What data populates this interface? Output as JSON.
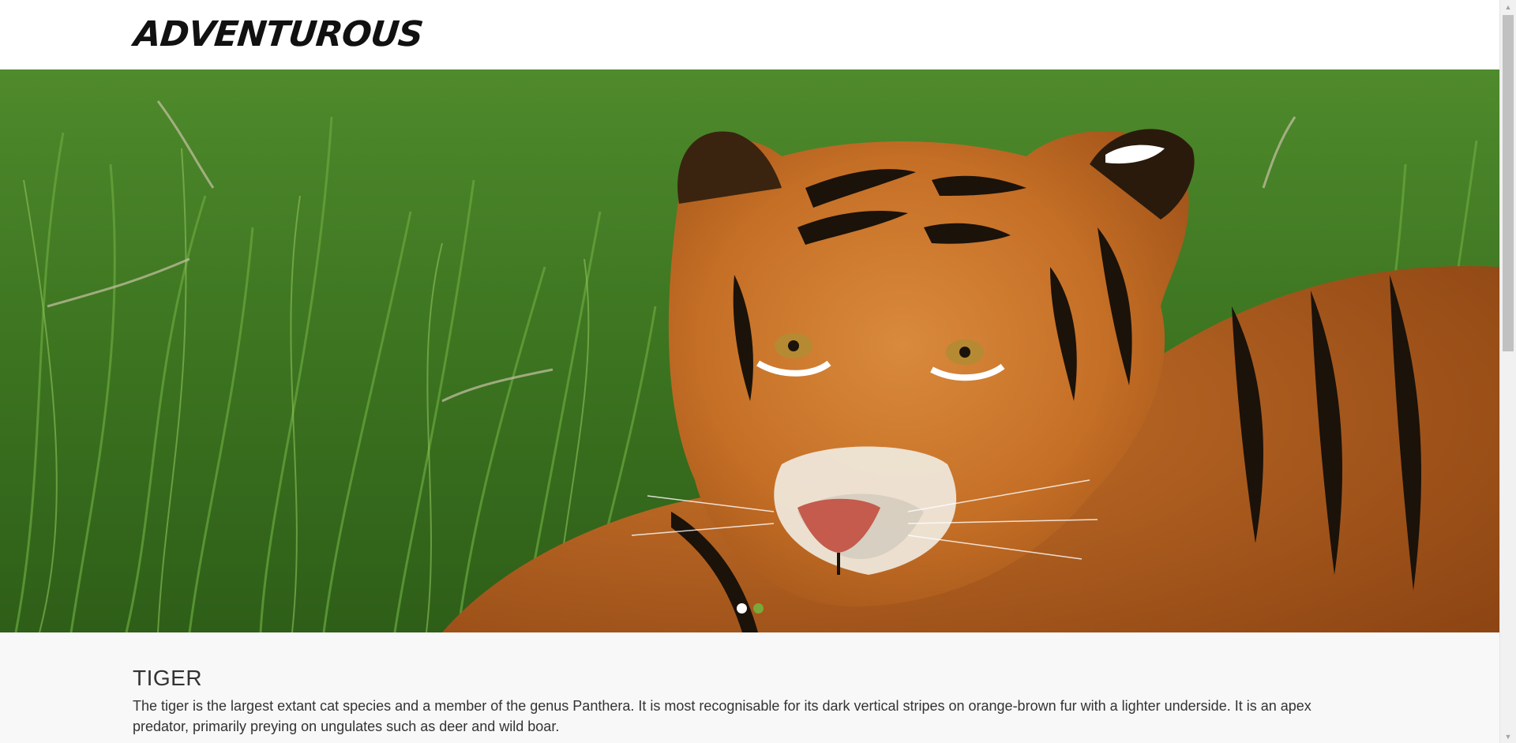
{
  "header": {
    "logo_text": "ADVENTUROUS"
  },
  "hero": {
    "image_subject": "tiger lying in grass",
    "slides": [
      {
        "active": true,
        "color": "#ffffff"
      },
      {
        "active": false,
        "color": "#7aa83a"
      }
    ]
  },
  "content": {
    "title": "TIGER",
    "body": "The tiger is the largest extant cat species and a member of the genus Panthera. It is most recognisable for its dark vertical stripes on orange-brown fur with a lighter underside. It is an apex predator, primarily preying on ungulates such as deer and wild boar."
  },
  "scrollbar": {
    "up_icon": "▲",
    "down_icon": "▼"
  },
  "colors": {
    "background": "#f8f8f8",
    "header_bg": "#ffffff",
    "text": "#333333",
    "accent_green": "#7aa83a"
  }
}
